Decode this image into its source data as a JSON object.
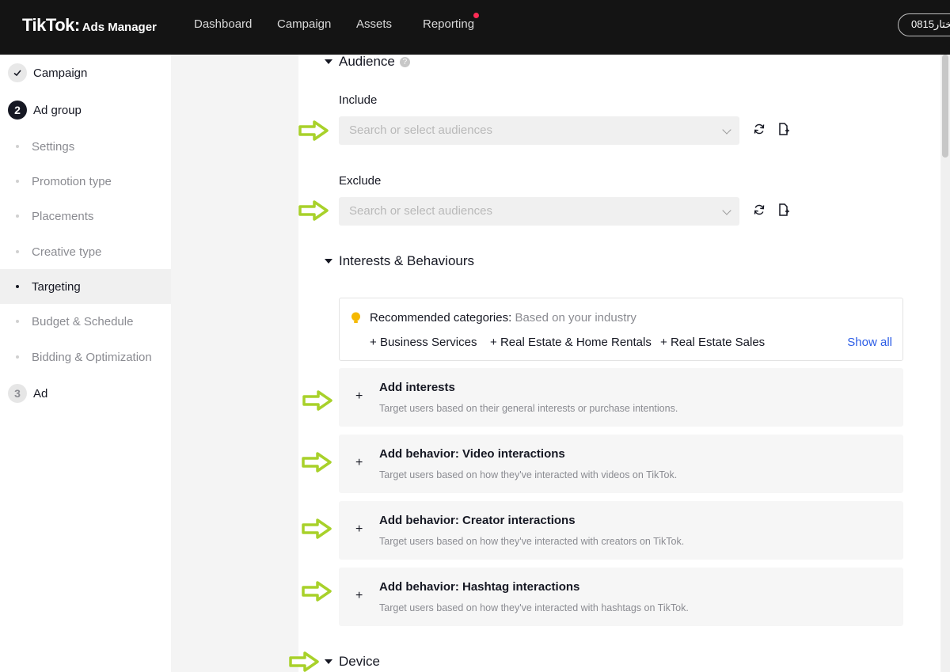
{
  "header": {
    "logo": "TikTok",
    "logo_suffix": "Ads Manager",
    "nav": [
      "Dashboard",
      "Campaign",
      "Assets",
      "Reporting"
    ],
    "account": "0815مختار"
  },
  "sidebar": {
    "campaign_label": "Campaign",
    "adgroup_number": "2",
    "adgroup_label": "Ad group",
    "items": [
      "Settings",
      "Promotion type",
      "Placements",
      "Creative type",
      "Targeting",
      "Budget & Schedule",
      "Bidding & Optimization"
    ],
    "active_item": "Targeting",
    "ad_number": "3",
    "ad_label": "Ad"
  },
  "audience": {
    "title": "Audience",
    "include_label": "Include",
    "exclude_label": "Exclude",
    "placeholder": "Search or select audiences"
  },
  "interests": {
    "title": "Interests & Behaviours",
    "recommended_label": "Recommended categories:",
    "recommended_sub": "Based on your industry",
    "chips": [
      "Business Services",
      "Real Estate & Home Rentals",
      "Real Estate Sales"
    ],
    "show_all": "Show all",
    "cards": [
      {
        "title": "Add interests",
        "desc": "Target users based on their general interests or purchase intentions."
      },
      {
        "title": "Add behavior: Video interactions",
        "desc": "Target users based on how they've interacted with videos on TikTok."
      },
      {
        "title": "Add behavior: Creator interactions",
        "desc": "Target users based on how they've interacted with creators on TikTok."
      },
      {
        "title": "Add behavior: Hashtag interactions",
        "desc": "Target users based on how they've interacted with hashtags on TikTok."
      }
    ]
  },
  "device": {
    "title": "Device"
  },
  "colors": {
    "accent_link": "#2b5ce6",
    "annotation_arrow": "#a8d12a",
    "topbar": "#141414"
  }
}
